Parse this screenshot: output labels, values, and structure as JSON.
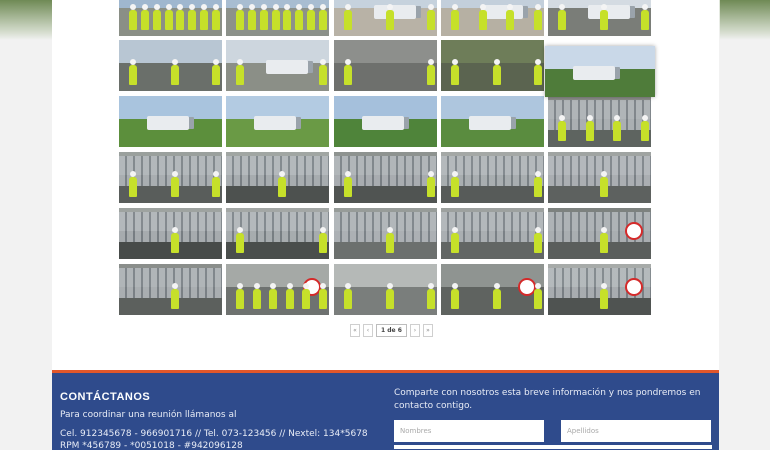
{
  "gallery": {
    "thumbnails": [
      {
        "row": 0,
        "col": 0,
        "scene": "team",
        "sky": "#9fb7cf",
        "ground": "#8a8f86",
        "people": 8
      },
      {
        "row": 0,
        "col": 1,
        "scene": "team",
        "sky": "#a8bdd1",
        "ground": "#8c918a",
        "people": 8
      },
      {
        "row": 0,
        "col": 2,
        "scene": "truck-yard",
        "sky": "#c6d2dd",
        "ground": "#b8b2a6",
        "people": 3
      },
      {
        "row": 0,
        "col": 3,
        "scene": "truck-yard",
        "sky": "#c3cfdb",
        "ground": "#b6b0a3",
        "people": 4
      },
      {
        "row": 0,
        "col": 4,
        "scene": "truck-people",
        "sky": "#d4dbe2",
        "ground": "#7a7d78",
        "people": 3
      },
      {
        "row": 1,
        "col": 0,
        "scene": "people",
        "sky": "#b8c6d3",
        "ground": "#6a6f6a",
        "people": 3
      },
      {
        "row": 1,
        "col": 1,
        "scene": "truck-people",
        "sky": "#cdd6de",
        "ground": "#8b8f87",
        "people": 2
      },
      {
        "row": 1,
        "col": 2,
        "scene": "people",
        "sky": "#8d8f8c",
        "ground": "#6e706d",
        "people": 2
      },
      {
        "row": 1,
        "col": 3,
        "scene": "people",
        "sky": "#6e7d59",
        "ground": "#5b6450",
        "people": 3
      },
      {
        "row": 1,
        "col": 4,
        "scene": "truck-road",
        "sky": "#c9d8e8",
        "ground": "#4f7c3a",
        "people": 0
      },
      {
        "row": 2,
        "col": 0,
        "scene": "truck-road",
        "sky": "#a9c4de",
        "ground": "#5c8f3c",
        "people": 0
      },
      {
        "row": 2,
        "col": 1,
        "scene": "truck-road",
        "sky": "#b3cbe2",
        "ground": "#6a9a45",
        "people": 0
      },
      {
        "row": 2,
        "col": 2,
        "scene": "truck-road",
        "sky": "#a5c0dc",
        "ground": "#4f843a",
        "people": 0
      },
      {
        "row": 2,
        "col": 3,
        "scene": "truck-road",
        "sky": "#aec6de",
        "ground": "#5a8c3f",
        "people": 0
      },
      {
        "row": 2,
        "col": 4,
        "scene": "cylinders",
        "sky": "#8b8d8a",
        "ground": "#5e6460",
        "people": 4
      },
      {
        "row": 3,
        "col": 0,
        "scene": "cylinders",
        "sky": "#9aa09d",
        "ground": "#595d5b",
        "people": 3
      },
      {
        "row": 3,
        "col": 1,
        "scene": "cylinders",
        "sky": "#a1a6a3",
        "ground": "#4d514f",
        "people": 1
      },
      {
        "row": 3,
        "col": 2,
        "scene": "cylinders",
        "sky": "#8e9390",
        "ground": "#505452",
        "people": 2
      },
      {
        "row": 3,
        "col": 3,
        "scene": "cylinders",
        "sky": "#a4a8a6",
        "ground": "#575b59",
        "people": 2
      },
      {
        "row": 3,
        "col": 4,
        "scene": "cylinders",
        "sky": "#a0a4a2",
        "ground": "#5d615f",
        "people": 1
      },
      {
        "row": 4,
        "col": 0,
        "scene": "cylinders",
        "sky": "#9ea3a0",
        "ground": "#474b49",
        "people": 1
      },
      {
        "row": 4,
        "col": 1,
        "scene": "cylinders",
        "sky": "#a3a7a5",
        "ground": "#4a4e4c",
        "people": 2
      },
      {
        "row": 4,
        "col": 2,
        "scene": "cylinders",
        "sky": "#979c99",
        "ground": "#6c706e",
        "people": 1
      },
      {
        "row": 4,
        "col": 3,
        "scene": "cylinders",
        "sky": "#9da19f",
        "ground": "#626664",
        "people": 2
      },
      {
        "row": 4,
        "col": 4,
        "scene": "sign",
        "sky": "#7d827f",
        "ground": "#5a5e5c",
        "people": 1
      },
      {
        "row": 5,
        "col": 0,
        "scene": "cylinders",
        "sky": "#8a8e8b",
        "ground": "#5c605d",
        "people": 1
      },
      {
        "row": 5,
        "col": 1,
        "scene": "team-sign",
        "sky": "#a5a9a6",
        "ground": "#6e7270",
        "people": 6
      },
      {
        "row": 5,
        "col": 2,
        "scene": "people",
        "sky": "#b5b9b7",
        "ground": "#7a7e7c",
        "people": 3
      },
      {
        "row": 5,
        "col": 3,
        "scene": "people-sign",
        "sky": "#8f9491",
        "ground": "#5f6360",
        "people": 3
      },
      {
        "row": 5,
        "col": 4,
        "scene": "sign",
        "sky": "#a7aba9",
        "ground": "#4f5351",
        "people": 1
      }
    ]
  },
  "pagination": {
    "first": "«",
    "prev": "‹",
    "current": "1 de 6",
    "next": "›",
    "last": "»"
  },
  "footer": {
    "contact": {
      "title": "CONTÁCTANOS",
      "subtitle": "Para coordinar una reunión llámanos al",
      "phones_line1": "Cel. 912345678 - 966901716   //   Tel. 073-123456   //   Nextel: 134*5678",
      "phones_line2": "RPM *456789 - *0051018 - #942096128"
    },
    "form": {
      "intro": "Comparte con nosotros esta breve información y nos pondremos en contacto contigo.",
      "first_name_placeholder": "Nombres",
      "last_name_placeholder": "Apellidos"
    }
  },
  "colors": {
    "accent_orange": "#e2572b",
    "footer_blue": "#2f4b8c",
    "vest_green": "#c6e02a"
  }
}
